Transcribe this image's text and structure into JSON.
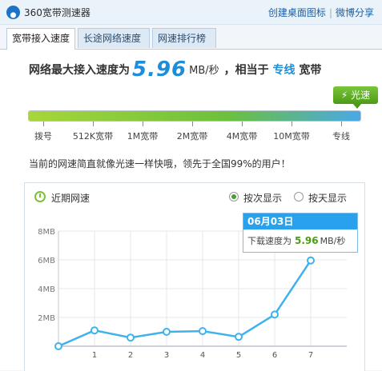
{
  "window": {
    "title": "360宽带测速器",
    "links": [
      "创建桌面图标",
      "微博分享"
    ],
    "separator": "|"
  },
  "tabs": [
    {
      "label": "宽带接入速度",
      "active": true
    },
    {
      "label": "长途网络速度",
      "active": false
    },
    {
      "label": "网速排行榜",
      "active": false
    }
  ],
  "headline": {
    "prefix": "网络最大接入速度为",
    "speed": "5.96",
    "unit": "MB/秒",
    "middle": "，相当于",
    "equivalent": "专线",
    "suffix": "宽带"
  },
  "badge": {
    "icon": "lightning-icon",
    "label": "光速"
  },
  "speed_scale": {
    "labels": [
      "拨号",
      "512K宽带",
      "1M宽带",
      "2M宽带",
      "4M宽带",
      "10M宽带",
      "专线"
    ],
    "fill_fraction": 1.0
  },
  "description": "当前的网速简直就像光速一样快哦，领先于全国99%的用户！",
  "recent": {
    "title": "近期网速",
    "icon": "clock-icon",
    "options": [
      {
        "label": "按次显示",
        "selected": true
      },
      {
        "label": "按天显示",
        "selected": false
      }
    ]
  },
  "tooltip": {
    "date": "06月03日",
    "label": "下载速度为",
    "value": "5.96",
    "unit": "MB/秒"
  },
  "chart_data": {
    "type": "line",
    "x": [
      0,
      1,
      2,
      3,
      4,
      5,
      6,
      7
    ],
    "values": [
      0,
      1.1,
      0.6,
      1.0,
      1.05,
      0.65,
      2.2,
      5.96
    ],
    "x_tick_labels": [
      "1",
      "2",
      "3",
      "4",
      "5",
      "6",
      "7"
    ],
    "y_tick_labels": [
      "2MB",
      "4MB",
      "6MB",
      "8MB"
    ],
    "y_ticks": [
      2,
      4,
      6,
      8
    ],
    "ylim": [
      0,
      8
    ],
    "xlim": [
      0,
      8
    ],
    "grid": true,
    "line_color": "#3fb2ec"
  },
  "colors": {
    "accent": "#1b8fdc",
    "green": "#4c9a16"
  }
}
